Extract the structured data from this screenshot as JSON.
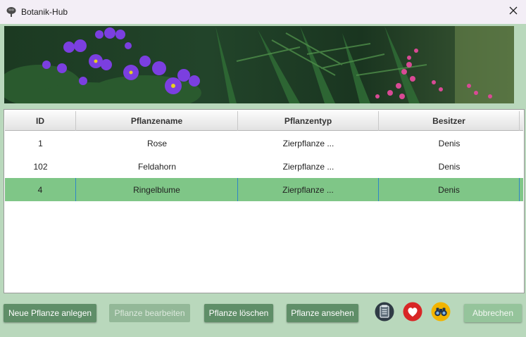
{
  "window": {
    "title": "Botanik-Hub"
  },
  "table": {
    "headers": [
      "ID",
      "Pflanzename",
      "Pflanzentyp",
      "Besitzer"
    ],
    "rows": [
      [
        "1",
        "Rose",
        "Zierpflanze ...",
        "Denis"
      ],
      [
        "102",
        "Feldahorn",
        "Zierpflanze ...",
        "Denis"
      ],
      [
        "4",
        "Ringelblume",
        "Zierpflanze ...",
        "Denis"
      ]
    ],
    "selected_index": 2
  },
  "buttons": {
    "new": "Neue Pflanze anlegen",
    "edit": "Pflanze bearbeiten",
    "delete": "Pflanze löschen",
    "view": "Pflanze ansehen",
    "cancel": "Abbrechen"
  },
  "icons": [
    "tree-icon",
    "close-icon",
    "notepad-icon",
    "heart-icon",
    "binoculars-icon"
  ],
  "colors": {
    "selected_row": "#7fc687",
    "button": "#5f8e68",
    "background": "#b9d8bc"
  }
}
